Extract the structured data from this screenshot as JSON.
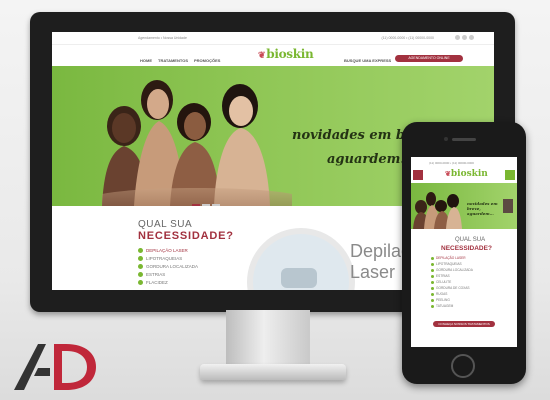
{
  "site": {
    "brand": "bioskin",
    "topbar_left": "Agendamento   •   Nossa Unidade",
    "topbar_right": "(11) 0000-0000   •   (11) 00000-0000",
    "nav_left": [
      "HOME",
      "TRATAMENTOS",
      "PROMOÇÕES"
    ],
    "nav_right": "BUSQUE UMA EXPRESS",
    "nav_button": "AGENDAMENTO ONLINE",
    "hero_line1": "novidades em breve,",
    "hero_line2": "aguardem...",
    "question_line1": "QUAL SUA",
    "question_line2": "NECESSIDADE?",
    "needs": [
      "DEPILAÇÃO LASER",
      "LIPOTRAQUEIAS",
      "GORDURA LOCALIZADA",
      "ESTRIAS",
      "FLACIDEZ"
    ],
    "feature_title_1": "Depilaç",
    "feature_title_2": "Laser"
  },
  "phone": {
    "hero_line": "novidades em breve, aguardem...",
    "question_line1": "QUAL SUA",
    "question_line2": "NECESSIDADE?",
    "needs": [
      "DEPILAÇÃO LASER",
      "LIPOTRAQUEIAS",
      "GORDURA LOCALIZADA",
      "ESTRIAS",
      "CELULITE",
      "GORDURA DE COXAS",
      "RUGAS",
      "PEELING",
      "TATUAGEM"
    ],
    "button": "CONHEÇA NOSSOS TRATAMENTOS"
  },
  "colors": {
    "brand_green": "#7ab731",
    "brand_red": "#a2313f",
    "hero_green": "#8fc655"
  },
  "icons": [
    "bioskin-logo-icon",
    "check-icon",
    "menu-icon",
    "whatsapp-icon"
  ]
}
